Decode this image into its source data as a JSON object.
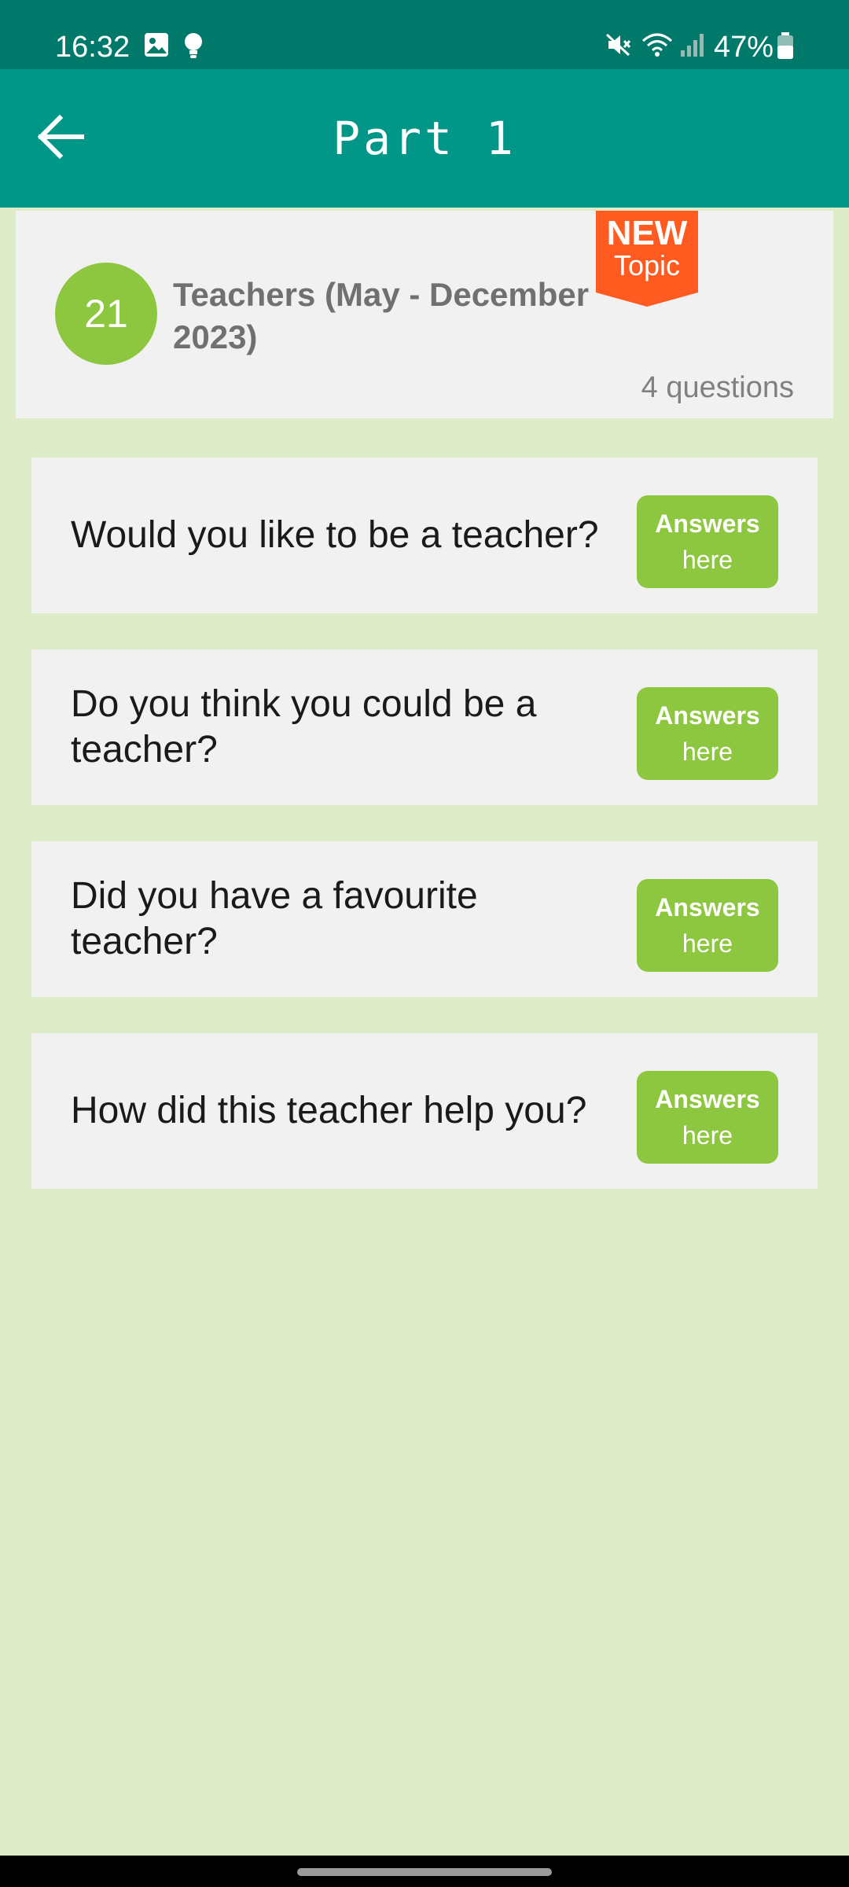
{
  "status_bar": {
    "time": "16:32",
    "battery": "47%",
    "icons": [
      "gallery-icon",
      "bulb-icon",
      "mute-icon",
      "wifi-icon",
      "signal-icon",
      "battery-icon"
    ]
  },
  "app_bar": {
    "title": "Part 1",
    "back_icon": "arrow-left-icon"
  },
  "topic": {
    "number": "21",
    "title": "Teachers (May - December 2023)",
    "count": "4 questions",
    "badge": {
      "line1": "NEW",
      "line2": "Topic",
      "color": "#ff5a1f"
    }
  },
  "questions": [
    {
      "text": "Would you like to be a teacher?",
      "button_line1": "Answers",
      "button_line2": "here"
    },
    {
      "text": "Do you think you could be a teacher?",
      "button_line1": "Answers",
      "button_line2": "here"
    },
    {
      "text": "Did you have a favourite teacher?",
      "button_line1": "Answers",
      "button_line2": "here"
    },
    {
      "text": "How did this teacher help you?",
      "button_line1": "Answers",
      "button_line2": "here"
    }
  ],
  "colors": {
    "status_bar": "#00796b",
    "app_bar": "#009688",
    "accent_green": "#8dc63f",
    "background": "#deebc8",
    "card": "#f1f1f1"
  }
}
